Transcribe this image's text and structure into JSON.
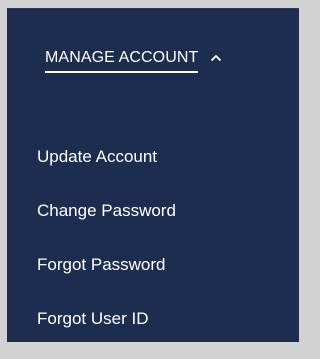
{
  "menu": {
    "header_label": "MANAGE ACCOUNT",
    "expanded": true,
    "toggle_icon": "chevron-up-icon",
    "items": [
      {
        "label": "Update Account"
      },
      {
        "label": "Change Password"
      },
      {
        "label": "Forgot Password"
      },
      {
        "label": "Forgot User ID"
      }
    ]
  },
  "colors": {
    "page_background": "#d2d2d2",
    "panel_background": "#1c2d4f",
    "text": "#ffffff"
  }
}
